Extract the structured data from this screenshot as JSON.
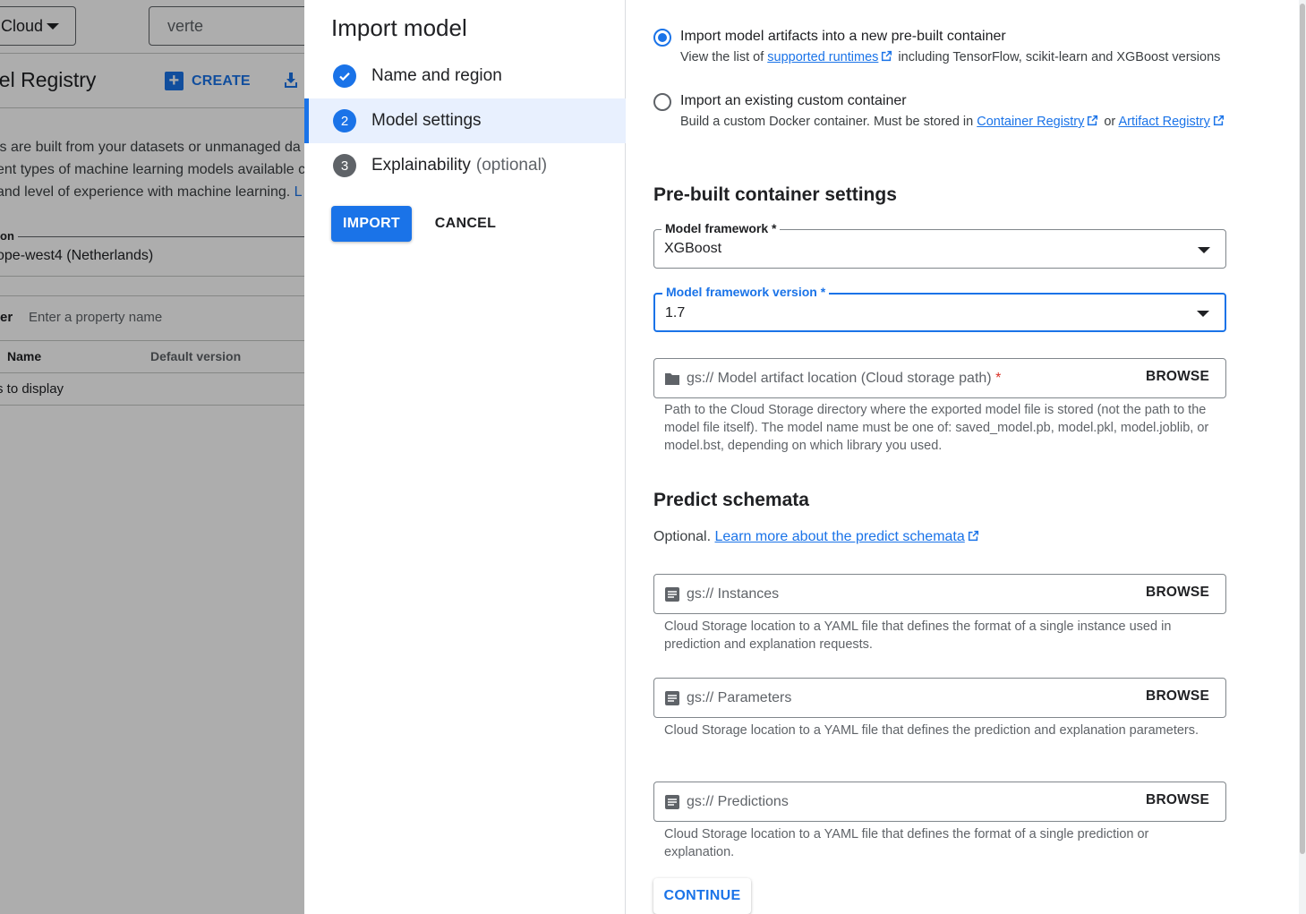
{
  "background": {
    "project_selector": "Cloud",
    "search_value": "verte",
    "title": "del Registry",
    "create_label": "CREATE",
    "description_lines": [
      "ls are built from your datasets or unmanaged da",
      "ent types of machine learning models available c",
      "and level of experience with machine learning."
    ],
    "description_link": "L",
    "region_label": "on",
    "region_value": "ope-west4 (Netherlands)",
    "filter_label": "er",
    "filter_placeholder": "Enter a property name",
    "columns": [
      "Name",
      "Default version"
    ],
    "empty_text": "s to display"
  },
  "dialog": {
    "title": "Import model",
    "steps": [
      {
        "num": "1",
        "label": "Name and region",
        "optional": "",
        "state": "done"
      },
      {
        "num": "2",
        "label": "Model settings",
        "optional": "",
        "state": "active"
      },
      {
        "num": "3",
        "label": "Explainability",
        "optional": "(optional)",
        "state": "todo"
      }
    ],
    "import_label": "IMPORT",
    "cancel_label": "CANCEL"
  },
  "container": {
    "option1": {
      "label": "Import model artifacts into a new pre-built container",
      "sub_pre": "View the list of",
      "sub_link": "supported runtimes",
      "sub_post": "including TensorFlow, scikit-learn and XGBoost versions",
      "selected": true
    },
    "option2": {
      "label": "Import an existing custom container",
      "sub_pre": "Build a custom Docker container. Must be stored in",
      "link1": "Container Registry",
      "or": "or",
      "link2": "Artifact Registry",
      "selected": false
    }
  },
  "prebuilt": {
    "heading": "Pre-built container settings",
    "framework_label": "Model framework *",
    "framework_value": "XGBoost",
    "version_label": "Model framework version *",
    "version_value": "1.7",
    "artifact_placeholder": "gs:// Model artifact location (Cloud storage path)",
    "artifact_required": "*",
    "browse_label": "BROWSE",
    "artifact_hint": "Path to the Cloud Storage directory where the exported model file is stored (not the path to the model file itself). The model name must be one of: saved_model.pb, model.pkl, model.joblib, or model.bst, depending on which library you used."
  },
  "schemata": {
    "heading": "Predict schemata",
    "optional_prefix": "Optional.",
    "learn_link": "Learn more about the predict schemata",
    "instances": {
      "placeholder": "gs:// Instances",
      "browse": "BROWSE",
      "hint": "Cloud Storage location to a YAML file that defines the format of a single instance used in prediction and explanation requests."
    },
    "parameters": {
      "placeholder": "gs:// Parameters",
      "browse": "BROWSE",
      "hint": "Cloud Storage location to a YAML file that defines the prediction and explanation parameters."
    },
    "predictions": {
      "placeholder": "gs:// Predictions",
      "browse": "BROWSE",
      "hint": "Cloud Storage location to a YAML file that defines the format of a single prediction or explanation."
    }
  },
  "continue_label": "CONTINUE",
  "colors": {
    "accent": "#1a73e8",
    "active_step_bg": "#e8f0fe",
    "required": "#d93025",
    "step_done": "#1a73e8",
    "step_todo": "#5f6368"
  }
}
